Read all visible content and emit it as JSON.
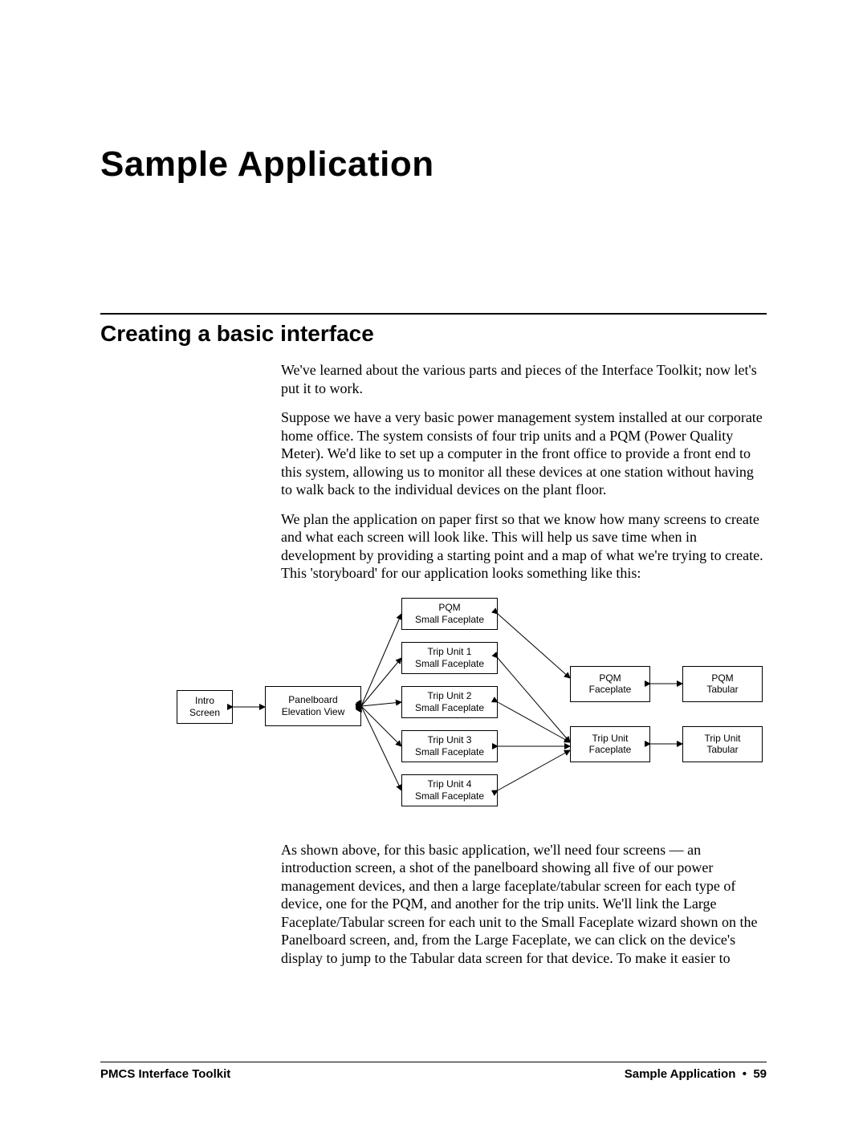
{
  "chapter_title": "Sample Application",
  "section_title": "Creating a basic interface",
  "paragraphs": {
    "p1": "We've learned about the various parts and pieces of the Interface Toolkit; now let's put it to work.",
    "p2": "Suppose we have a very basic power management system installed at our corporate home office. The system consists of four trip units and a PQM (Power Quality Meter). We'd like to set up a computer in the front office to provide a front end to this system, allowing us to monitor all these devices at one station without having to walk back to the individual devices on the plant floor.",
    "p3": "We plan the application on paper first so that we know how many screens to create and what each screen will look like. This will help us save time when in development by providing a starting point and a map of what we're trying to create. This 'storyboard' for our application looks something like this:",
    "p4": "As shown above, for this basic application, we'll need four screens — an introduction screen, a shot of the panelboard showing all five of our power management devices, and then a large faceplate/tabular screen for each type of device, one for the PQM, and another for the trip units. We'll link the Large Faceplate/Tabular screen for each unit to the Small Faceplate wizard shown on the Panelboard screen, and, from the Large Faceplate, we can click on the device's display to jump to the Tabular data screen for that device. To make it easier to"
  },
  "diagram": {
    "intro": "Intro\nScreen",
    "panelboard": "Panelboard\nElevation View",
    "sf_pqm": "PQM\nSmall Faceplate",
    "sf_tu1": "Trip Unit 1\nSmall Faceplate",
    "sf_tu2": "Trip Unit 2\nSmall Faceplate",
    "sf_tu3": "Trip Unit 3\nSmall Faceplate",
    "sf_tu4": "Trip Unit 4\nSmall Faceplate",
    "pqm_face": "PQM\nFaceplate",
    "pqm_tab": "PQM\nTabular",
    "tu_face": "Trip Unit\nFaceplate",
    "tu_tab": "Trip Unit\nTabular"
  },
  "footer": {
    "left": "PMCS Interface Toolkit",
    "right_label": "Sample Application",
    "bullet": "•",
    "page_no": "59"
  }
}
